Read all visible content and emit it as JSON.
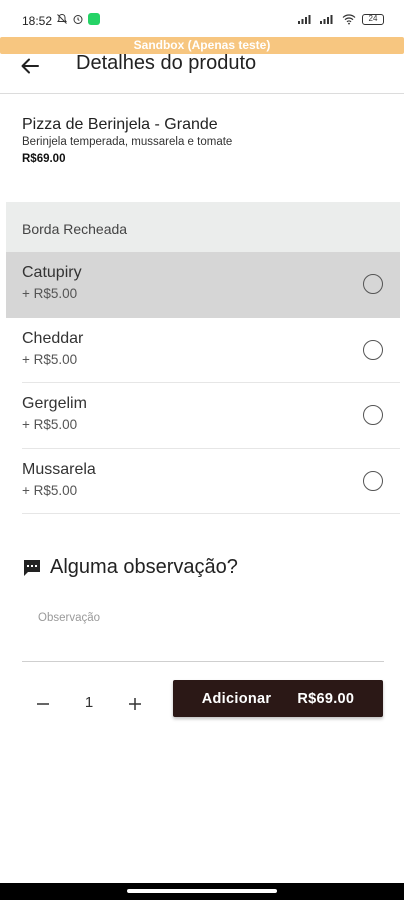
{
  "status_bar": {
    "time": "18:52",
    "battery": "24"
  },
  "sandbox_banner": "Sandbox (Apenas teste)",
  "header": {
    "title": "Detalhes do produto"
  },
  "product": {
    "name": "Pizza de Berinjela - Grande",
    "description": "Berinjela temperada, mussarela e tomate",
    "price": "R$69.00"
  },
  "section": {
    "title": "Borda Recheada"
  },
  "options": [
    {
      "name": "Catupiry",
      "price": "+ R$5.00",
      "selected": true
    },
    {
      "name": "Cheddar",
      "price": "+ R$5.00",
      "selected": false
    },
    {
      "name": "Gergelim",
      "price": "+ R$5.00",
      "selected": false
    },
    {
      "name": "Mussarela",
      "price": "+ R$5.00",
      "selected": false
    }
  ],
  "observation": {
    "title": "Alguma observação?",
    "placeholder": "Observação",
    "value": ""
  },
  "quantity": {
    "value": "1"
  },
  "add_button": {
    "label": "Adicionar",
    "price": "R$69.00"
  },
  "colors": {
    "banner": "#f7c680",
    "add_button": "#2b1816",
    "selected_row": "#d6d6d6",
    "section_header": "#ebedec"
  }
}
